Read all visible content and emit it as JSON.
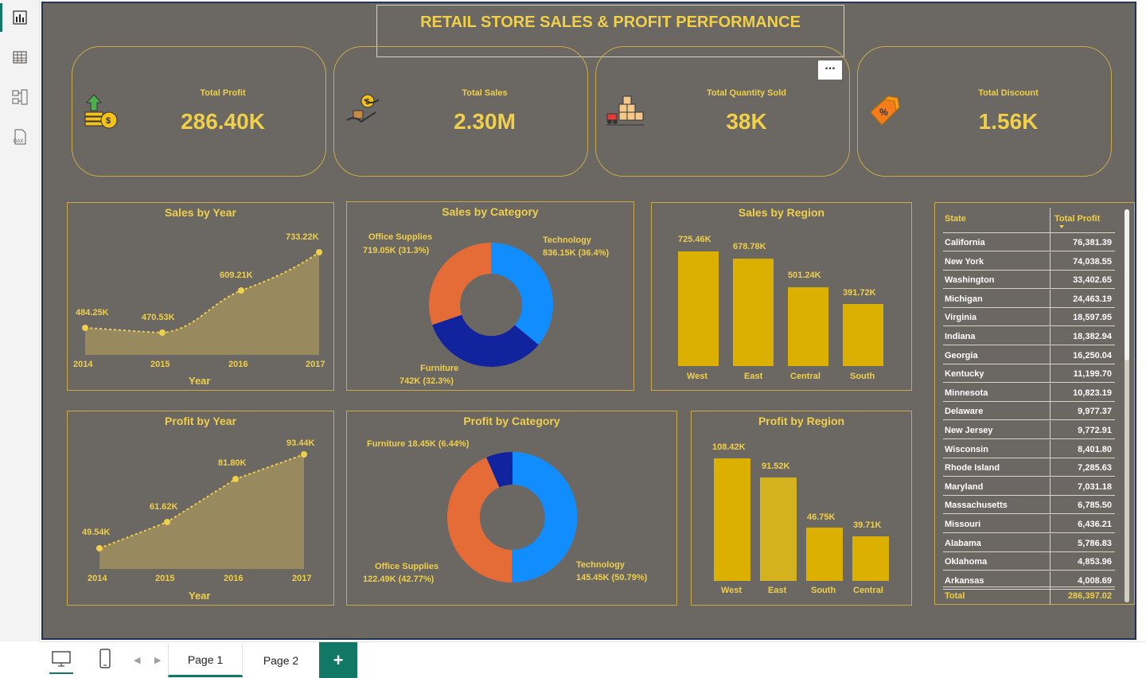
{
  "title": "RETAIL STORE SALES & PROFIT PERFORMANCE",
  "rail": {
    "icons": [
      "report-view-icon",
      "table-view-icon",
      "model-view-icon",
      "dax-query-icon"
    ],
    "dax_label": "DAX"
  },
  "kpis": [
    {
      "title": "Total Profit",
      "value": "286.40K",
      "icon": "money-bags-icon"
    },
    {
      "title": "Total Sales",
      "value": "2.30M",
      "icon": "hand-exchange-icon"
    },
    {
      "title": "Total Quantity Sold",
      "value": "38K",
      "icon": "forklift-boxes-icon"
    },
    {
      "title": "Total Discount",
      "value": "1.56K",
      "icon": "discount-tag-icon"
    }
  ],
  "more_options_label": "...",
  "sales_by_year": {
    "title": "Sales by Year",
    "xlabel": "Year",
    "years": [
      "2014",
      "2015",
      "2016",
      "2017"
    ],
    "labels": [
      "484.25K",
      "470.53K",
      "609.21K",
      "733.22K"
    ]
  },
  "sales_by_category": {
    "title": "Sales by Category",
    "labels": {
      "office_name": "Office Supplies",
      "office_val": "719.05K (31.3%)",
      "tech_name": "Technology",
      "tech_val": "836.15K (36.4%)",
      "furn_name": "Furniture",
      "furn_val": "742K (32.3%)"
    }
  },
  "sales_by_region": {
    "title": "Sales by Region",
    "regions": [
      "West",
      "East",
      "Central",
      "South"
    ],
    "labels": [
      "725.46K",
      "678.78K",
      "501.24K",
      "391.72K"
    ]
  },
  "profit_by_year": {
    "title": "Profit by Year",
    "xlabel": "Year",
    "years": [
      "2014",
      "2015",
      "2016",
      "2017"
    ],
    "labels": [
      "49.54K",
      "61.62K",
      "81.80K",
      "93.44K"
    ]
  },
  "profit_by_category": {
    "title": "Profit by Category",
    "labels": {
      "furn": "Furniture 18.45K (6.44%)",
      "office_name": "Office Supplies",
      "office_val": "122.49K (42.77%)",
      "tech_name": "Technology",
      "tech_val": "145.45K (50.79%)"
    }
  },
  "profit_by_region": {
    "title": "Profit by Region",
    "regions": [
      "West",
      "East",
      "South",
      "Central"
    ],
    "labels": [
      "108.42K",
      "91.52K",
      "46.75K",
      "39.71K"
    ]
  },
  "table": {
    "col_state": "State",
    "col_profit": "Total Profit",
    "rows": [
      [
        "California",
        "76,381.39"
      ],
      [
        "New York",
        "74,038.55"
      ],
      [
        "Washington",
        "33,402.65"
      ],
      [
        "Michigan",
        "24,463.19"
      ],
      [
        "Virginia",
        "18,597.95"
      ],
      [
        "Indiana",
        "18,382.94"
      ],
      [
        "Georgia",
        "16,250.04"
      ],
      [
        "Kentucky",
        "11,199.70"
      ],
      [
        "Minnesota",
        "10,823.19"
      ],
      [
        "Delaware",
        "9,977.37"
      ],
      [
        "New Jersey",
        "9,772.91"
      ],
      [
        "Wisconsin",
        "8,401.80"
      ],
      [
        "Rhode Island",
        "7,285.63"
      ],
      [
        "Maryland",
        "7,031.18"
      ],
      [
        "Massachusetts",
        "6,785.50"
      ],
      [
        "Missouri",
        "6,436.21"
      ],
      [
        "Alabama",
        "5,786.83"
      ],
      [
        "Oklahoma",
        "4,853.96"
      ],
      [
        "Arkansas",
        "4,008.69"
      ]
    ],
    "total_label": "Total",
    "total_value": "286,397.02"
  },
  "pages": {
    "page1": "Page 1",
    "page2": "Page 2",
    "add": "+"
  },
  "colors": {
    "gold": "#f0cf4a",
    "bar": "#dcb000",
    "donut_blue": "#118dff",
    "donut_orange": "#e66c37",
    "donut_navy": "#12239e",
    "accent": "#117865"
  },
  "chart_data": [
    {
      "type": "area",
      "title": "Sales by Year",
      "xlabel": "Year",
      "ylabel": "",
      "x": [
        "2014",
        "2015",
        "2016",
        "2017"
      ],
      "values": [
        484.25,
        470.53,
        609.21,
        733.22
      ],
      "units": "K"
    },
    {
      "type": "pie",
      "title": "Sales by Category",
      "categories": [
        "Technology",
        "Furniture",
        "Office Supplies"
      ],
      "values": [
        836.15,
        742,
        719.05
      ],
      "percents": [
        36.4,
        32.3,
        31.3
      ],
      "units": "K"
    },
    {
      "type": "bar",
      "title": "Sales by Region",
      "categories": [
        "West",
        "East",
        "Central",
        "South"
      ],
      "values": [
        725.46,
        678.78,
        501.24,
        391.72
      ],
      "units": "K"
    },
    {
      "type": "area",
      "title": "Profit by Year",
      "xlabel": "Year",
      "ylabel": "",
      "x": [
        "2014",
        "2015",
        "2016",
        "2017"
      ],
      "values": [
        49.54,
        61.62,
        81.8,
        93.44
      ],
      "units": "K"
    },
    {
      "type": "pie",
      "title": "Profit by Category",
      "categories": [
        "Technology",
        "Office Supplies",
        "Furniture"
      ],
      "values": [
        145.45,
        122.49,
        18.45
      ],
      "percents": [
        50.79,
        42.77,
        6.44
      ],
      "units": "K"
    },
    {
      "type": "bar",
      "title": "Profit by Region",
      "categories": [
        "West",
        "East",
        "South",
        "Central"
      ],
      "values": [
        108.42,
        91.52,
        46.75,
        39.71
      ],
      "units": "K"
    }
  ]
}
